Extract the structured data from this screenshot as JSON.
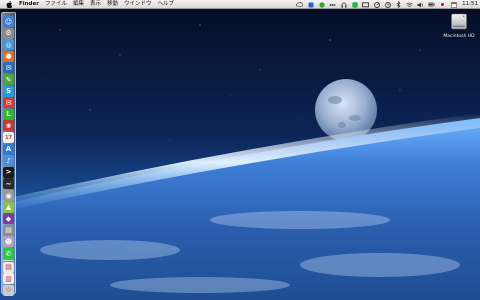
{
  "menubar": {
    "app_name": "Finder",
    "menus": [
      "ファイル",
      "編集",
      "表示",
      "移動",
      "ウインドウ",
      "ヘルプ"
    ],
    "clock": "11:51",
    "status_icons": [
      "cloud-icon",
      "app-status-icon",
      "evernote-icon",
      "dots-icon",
      "headphones-icon",
      "line-icon",
      "screen-icon",
      "dashboard-icon",
      "timemachine-icon",
      "bluetooth-icon",
      "wifi-icon",
      "volume-icon",
      "battery-icon",
      "flag-icon",
      "calendar-icon"
    ]
  },
  "desktop": {
    "drive_label": "Macintosh HD"
  },
  "dock": {
    "items": [
      {
        "name": "finder-icon",
        "color": "#3d7fd6",
        "glyph": "☺"
      },
      {
        "name": "system-preferences-icon",
        "color": "#8a8a8a",
        "glyph": "⚙"
      },
      {
        "name": "safari-icon",
        "color": "#3b9be0",
        "glyph": "◎"
      },
      {
        "name": "firefox-icon",
        "color": "#e66a1f",
        "glyph": "●"
      },
      {
        "name": "thunderbird-icon",
        "color": "#2c6db8",
        "glyph": "✉"
      },
      {
        "name": "evernote-icon",
        "color": "#4fa63a",
        "glyph": "✎"
      },
      {
        "name": "skype-icon",
        "color": "#1ea0e0",
        "glyph": "S"
      },
      {
        "name": "mail-icon",
        "color": "#d83a2e",
        "glyph": "✉"
      },
      {
        "name": "line-app-icon",
        "color": "#2eb82e",
        "glyph": "L"
      },
      {
        "name": "photos-icon",
        "color": "#c23a3a",
        "glyph": "❀"
      },
      {
        "name": "calendar-icon",
        "color": "#f2f2f2",
        "glyph": "17"
      },
      {
        "name": "app-store-icon",
        "color": "#2a7dd4",
        "glyph": "A"
      },
      {
        "name": "itunes-icon",
        "color": "#4a8fe0",
        "glyph": "♪"
      },
      {
        "name": "terminal-icon",
        "color": "#1a1a1a",
        "glyph": ">"
      },
      {
        "name": "activity-monitor-icon",
        "color": "#2a2a2a",
        "glyph": "~"
      },
      {
        "name": "disk-utility-icon",
        "color": "#9a9a9a",
        "glyph": "◉"
      },
      {
        "name": "android-icon",
        "color": "#8bc34a",
        "glyph": "▲"
      },
      {
        "name": "game-icon",
        "color": "#7a3aa0",
        "glyph": "◆"
      },
      {
        "name": "parallels-icon",
        "color": "#8c8c8c",
        "glyph": "▤"
      },
      {
        "name": "automator-icon",
        "color": "#b0a0c8",
        "glyph": "☻"
      },
      {
        "name": "line-messenger-icon",
        "color": "#27c93f",
        "glyph": "✆"
      },
      {
        "name": "downloads-stack-icon",
        "color": "#e8e8e8",
        "glyph": "▤"
      },
      {
        "name": "documents-stack-icon",
        "color": "#f0f0f0",
        "glyph": "▥"
      },
      {
        "name": "trash-icon",
        "color": "#c9ccd2",
        "glyph": "♲"
      }
    ]
  }
}
